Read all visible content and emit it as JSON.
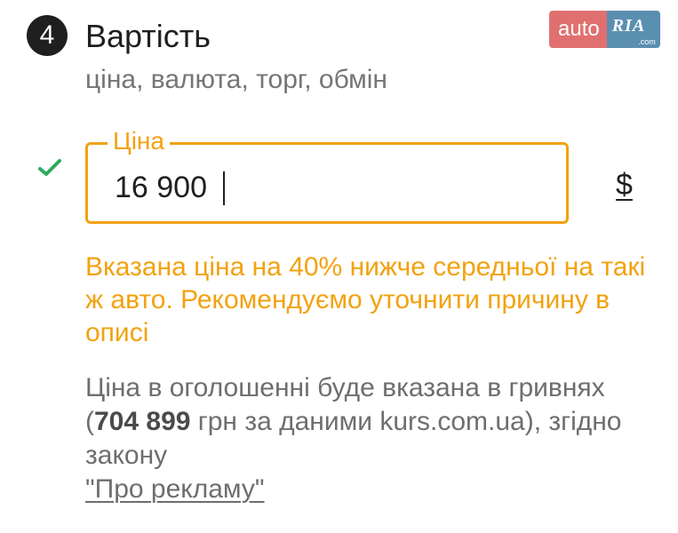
{
  "section": {
    "step_number": "4",
    "title": "Вартість",
    "subtitle": "ціна, валюта, торг, обмін"
  },
  "logo": {
    "auto_text": "auto",
    "ria_text": "RIA",
    "com_text": ".com"
  },
  "price_field": {
    "label": "Ціна",
    "value": "16 900",
    "currency_symbol": "$",
    "valid_icon": "check-icon"
  },
  "warning": {
    "text": "Вказана ціна на 40% нижче середньої на такі ж авто. Рекомендуємо уточнити причину в описі"
  },
  "info": {
    "part1": "Ціна в оголошенні буде вказана в гривнях (",
    "uah_amount": "704 899",
    "part2": " грн за даними kurs.com.ua), згідно закону ",
    "law_link": "\"Про рекламу\""
  },
  "colors": {
    "accent_orange": "#f2a20f",
    "check_green": "#2eaa5c",
    "logo_red": "#e07070",
    "logo_blue": "#5a8fb0"
  }
}
